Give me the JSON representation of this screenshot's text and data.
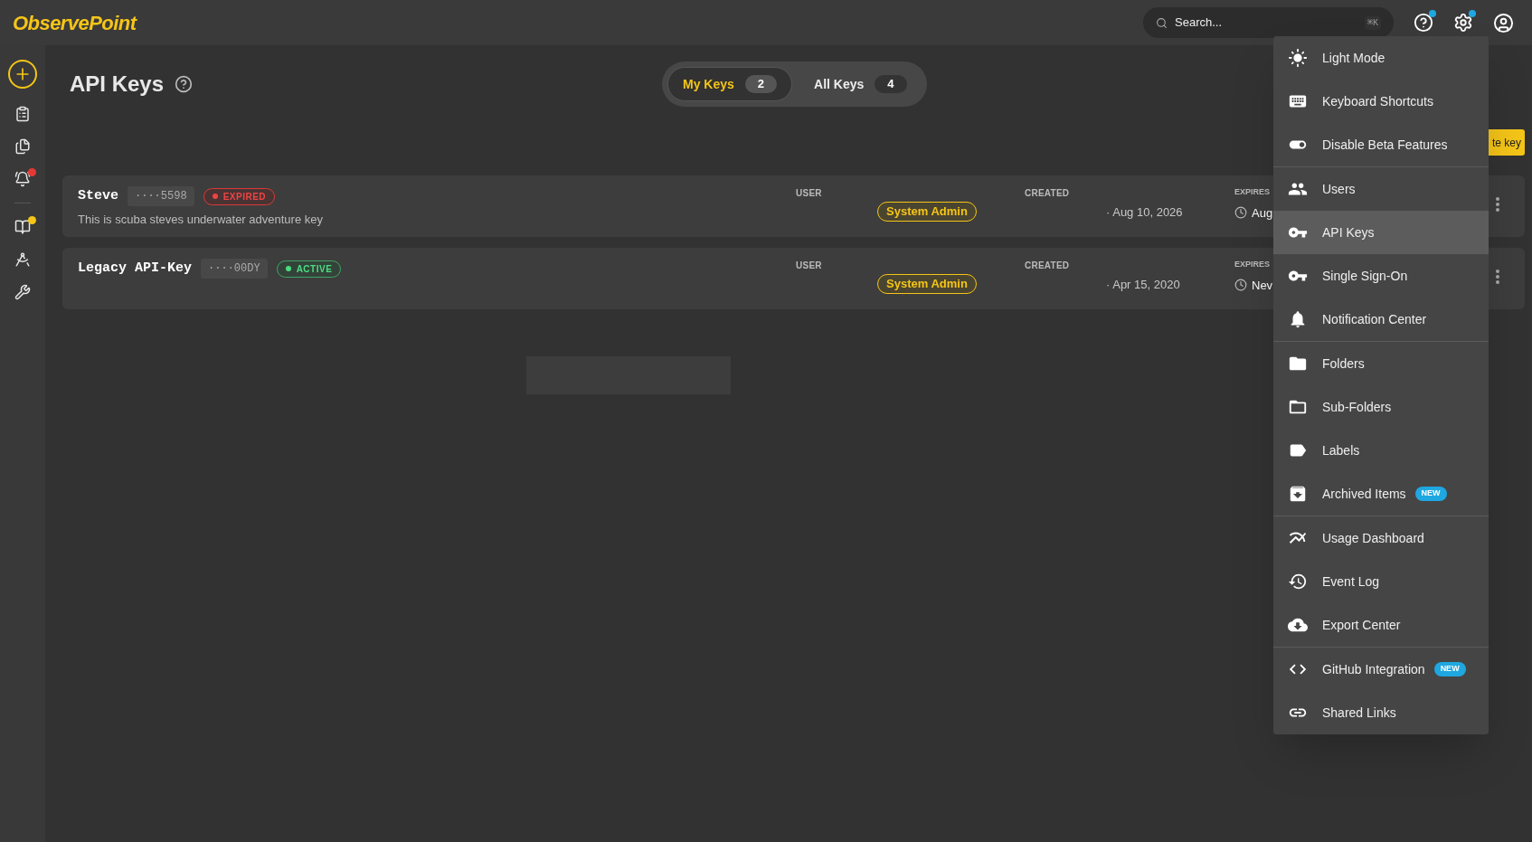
{
  "header": {
    "logo": "ObservePoint",
    "search": {
      "placeholder": "Search...",
      "shortcut": "⌘K"
    },
    "help_dot": true,
    "settings_dot": true
  },
  "sidebar": {
    "items": [
      {
        "kind": "add"
      },
      {
        "kind": "nav"
      },
      {
        "kind": "nav"
      },
      {
        "kind": "nav",
        "color": "#e53935"
      },
      {
        "kind": "divider"
      },
      {
        "kind": "nav",
        "color": "#f5c518"
      },
      {
        "kind": "nav"
      },
      {
        "kind": "nav"
      }
    ]
  },
  "page": {
    "title": "API Keys",
    "tabs": [
      {
        "label": "My Keys",
        "count": "2",
        "selected": true
      },
      {
        "label": "All Keys",
        "count": "4",
        "selected": false
      }
    ],
    "create_button": "te key",
    "keys": [
      {
        "name": "Steve",
        "masked": "····5598",
        "kind": "expired",
        "status_label": "EXPIRED",
        "description": "This is scuba steves underwater adventure key",
        "user_label": "USER",
        "role": "System Admin",
        "created_label": "CREATED",
        "created": "· Aug 10, 2026",
        "expires_label": "EXPIRES",
        "expires": "Aug"
      },
      {
        "name": "Legacy API-Key",
        "masked": "····00DY",
        "kind": "active",
        "status_label": "ACTIVE",
        "user_label": "USER",
        "role": "System Admin",
        "created_label": "CREATED",
        "created": "· Apr 15, 2020",
        "expires_label": "EXPIRES",
        "expires": "Nev"
      }
    ]
  },
  "settings_menu": {
    "groups": [
      {
        "items": [
          {
            "label": "Light Mode",
            "selected": false
          },
          {
            "label": "Keyboard Shortcuts",
            "selected": false
          },
          {
            "label": "Disable Beta Features",
            "selected": false
          }
        ]
      },
      {
        "items": [
          {
            "label": "Users",
            "selected": false
          },
          {
            "label": "API Keys",
            "selected": true
          },
          {
            "label": "Single Sign-On",
            "selected": false
          },
          {
            "label": "Notification Center",
            "selected": false
          }
        ]
      },
      {
        "items": [
          {
            "label": "Folders",
            "selected": false
          },
          {
            "label": "Sub-Folders",
            "selected": false
          },
          {
            "label": "Labels",
            "selected": false
          },
          {
            "label": "Archived Items",
            "selected": false,
            "badge": "NEW"
          }
        ]
      },
      {
        "items": [
          {
            "label": "Usage Dashboard",
            "selected": false
          },
          {
            "label": "Event Log",
            "selected": false
          },
          {
            "label": "Export Center",
            "selected": false
          }
        ]
      },
      {
        "items": [
          {
            "label": "GitHub Integration",
            "selected": false,
            "badge": "NEW"
          },
          {
            "label": "Shared Links",
            "selected": false
          }
        ]
      }
    ]
  }
}
